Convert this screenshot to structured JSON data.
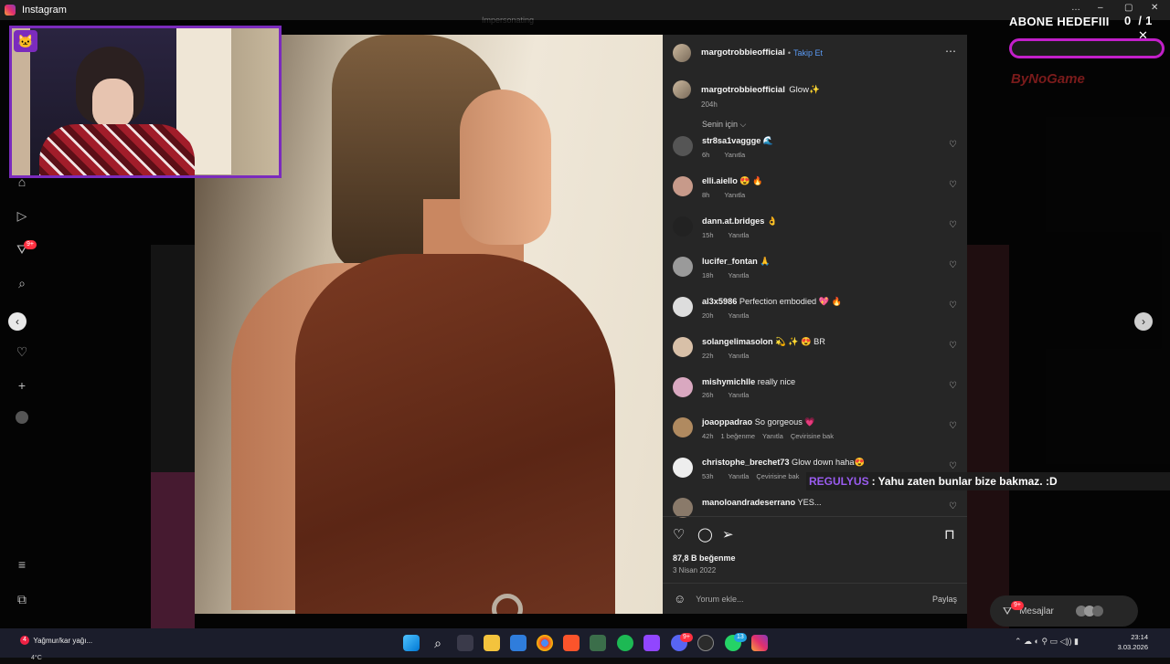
{
  "window": {
    "title": "Instagram",
    "controls": [
      "…",
      "–",
      "▢",
      "✕"
    ]
  },
  "sidenav": {
    "badge": "9+"
  },
  "post": {
    "username": "margotrobbieofficial",
    "follow_separator": "•",
    "follow_label": "Takip Et",
    "more_icon": "⋯",
    "caption_text": "Glow✨",
    "caption_time": "204h",
    "sort_label": "Senin için ⌵",
    "likes": "87,8 B beğenme",
    "date": "3 Nisan 2022",
    "add_comment_placeholder": "Yorum ekle...",
    "share_label": "Paylaş",
    "comments": [
      {
        "user": "str8sa1vaggge",
        "text": "🌊",
        "time": "6h",
        "reply": "Yanıtla",
        "likes": "",
        "translate": "",
        "avatar_color": "#555555"
      },
      {
        "user": "elli.aiello",
        "text": "😍 🔥",
        "time": "8h",
        "reply": "Yanıtla",
        "likes": "",
        "translate": "",
        "avatar_color": "#c79a8a"
      },
      {
        "user": "dann.at.bridges",
        "text": "👌",
        "time": "15h",
        "reply": "Yanıtla",
        "likes": "",
        "translate": "",
        "avatar_color": "#222222"
      },
      {
        "user": "lucifer_fontan",
        "text": "🙏",
        "time": "18h",
        "reply": "Yanıtla",
        "likes": "",
        "translate": "",
        "avatar_color": "#9a9a9a"
      },
      {
        "user": "al3x5986",
        "text": "Perfection embodied 💖 🔥",
        "time": "20h",
        "reply": "Yanıtla",
        "likes": "",
        "translate": "",
        "avatar_color": "#dddddd"
      },
      {
        "user": "solangelimasolon",
        "text": "💫 ✨ 😍 BR",
        "time": "22h",
        "reply": "Yanıtla",
        "likes": "",
        "translate": "",
        "avatar_color": "#d8c0a8"
      },
      {
        "user": "mishymichlle",
        "text": "really nice",
        "time": "26h",
        "reply": "Yanıtla",
        "likes": "",
        "translate": "",
        "avatar_color": "#d9a8c0"
      },
      {
        "user": "joaoppadrao",
        "text": "So gorgeous 💗",
        "time": "42h",
        "reply": "Yanıtla",
        "likes": "1 beğenme",
        "translate": "Çevirisine bak",
        "avatar_color": "#b08a60"
      },
      {
        "user": "christophe_brechet73",
        "text": "Glow down haha😍",
        "time": "53h",
        "reply": "Yanıtla",
        "likes": "",
        "translate": "Çevirisine bak",
        "avatar_color": "#eeeeee"
      },
      {
        "user": "manoloandradeserrano",
        "text": "YES...",
        "time": "",
        "reply": "",
        "likes": "",
        "translate": "",
        "avatar_color": "#8a7a6a"
      }
    ]
  },
  "stream_overlay": {
    "goal_title": "ABONE HEDEFIII",
    "goal_count": "0  / 1",
    "brand": "ByNoGame",
    "chat_user": "REGULYUS",
    "chat_sep": ":",
    "chat_message": "Yahu zaten bunlar bize bakmaz. :D"
  },
  "background": {
    "header_text": "Impersonating"
  },
  "messages": {
    "label": "Mesajlar",
    "badge": "9+"
  },
  "taskbar": {
    "weather_line1": "Yağmur/kar yağı...",
    "weather_line2": "4°C",
    "weather_badge": "4",
    "time": "23:14",
    "date": "3.03.2026",
    "badges": {
      "discord": "9+",
      "whatsapp": "13"
    }
  },
  "colors": {
    "accent_purple": "#7b2bbd",
    "goal_border": "#c21fc9",
    "follow_blue": "#5b9bf5",
    "chat_user": "#9a5cf0"
  }
}
